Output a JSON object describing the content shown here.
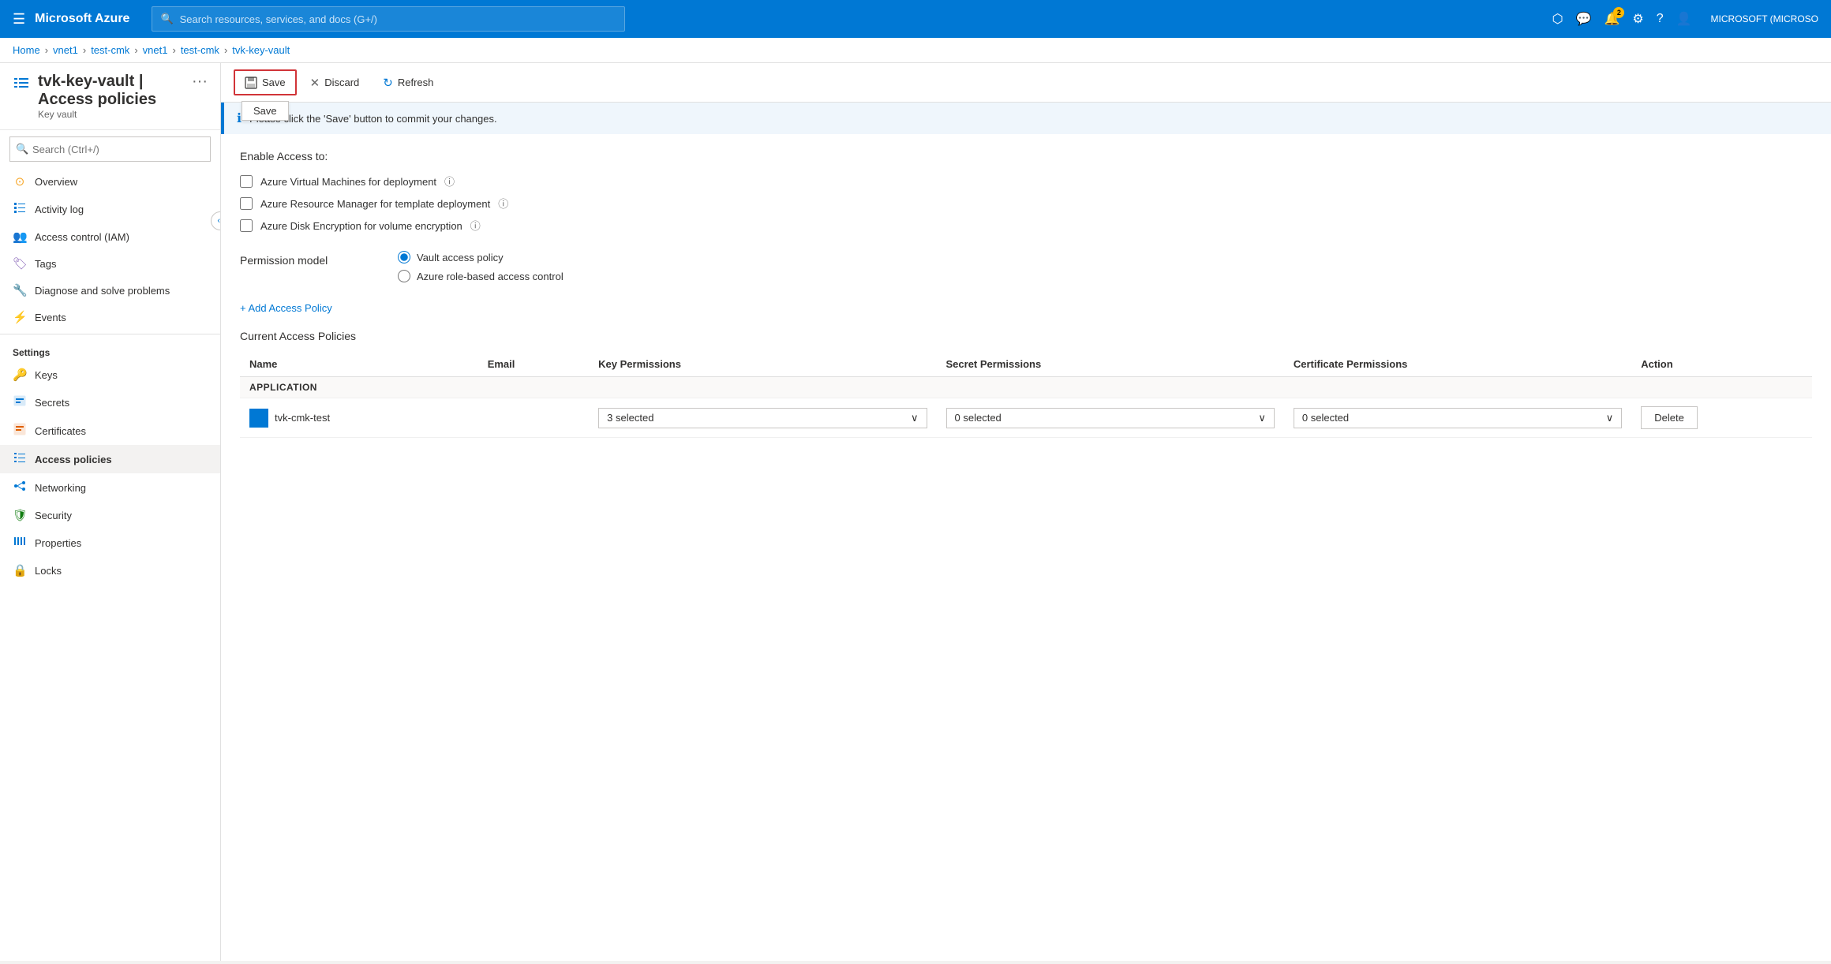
{
  "topnav": {
    "brand": "Microsoft Azure",
    "search_placeholder": "Search resources, services, and docs (G+/)",
    "notification_count": "2",
    "user_label": "MICROSOFT (MICROSO"
  },
  "breadcrumb": {
    "items": [
      "Home",
      "vnet1",
      "test-cmk",
      "vnet1",
      "test-cmk",
      "tvk-key-vault"
    ]
  },
  "page": {
    "title": "tvk-key-vault | Access policies",
    "subtitle": "Key vault"
  },
  "toolbar": {
    "save_label": "Save",
    "discard_label": "Discard",
    "refresh_label": "Refresh",
    "save_tooltip": "Save"
  },
  "info_banner": {
    "message": "Please click the 'Save' button to commit your changes."
  },
  "enable_access": {
    "title": "Enable Access to:",
    "options": [
      {
        "id": "vm",
        "label": "Azure Virtual Machines for deployment",
        "checked": false
      },
      {
        "id": "arm",
        "label": "Azure Resource Manager for template deployment",
        "checked": false
      },
      {
        "id": "disk",
        "label": "Azure Disk Encryption for volume encryption",
        "checked": false
      }
    ]
  },
  "permission_model": {
    "label": "Permission model",
    "options": [
      {
        "id": "vault",
        "label": "Vault access policy",
        "selected": true
      },
      {
        "id": "rbac",
        "label": "Azure role-based access control",
        "selected": false
      }
    ]
  },
  "add_policy": {
    "label": "+ Add Access Policy"
  },
  "current_policies": {
    "title": "Current Access Policies",
    "headers": [
      "Name",
      "Email",
      "Key Permissions",
      "Secret Permissions",
      "Certificate Permissions",
      "Action"
    ],
    "sections": [
      {
        "section_name": "APPLICATION",
        "rows": [
          {
            "name": "tvk-cmk-test",
            "email": "",
            "key_permissions": "3 selected",
            "secret_permissions": "0 selected",
            "certificate_permissions": "0 selected"
          }
        ]
      }
    ]
  },
  "sidebar": {
    "search_placeholder": "Search (Ctrl+/)",
    "items_general": [
      {
        "id": "overview",
        "label": "Overview",
        "icon": "⊙"
      },
      {
        "id": "activity-log",
        "label": "Activity log",
        "icon": "≡"
      },
      {
        "id": "access-control",
        "label": "Access control (IAM)",
        "icon": "👥"
      },
      {
        "id": "tags",
        "label": "Tags",
        "icon": "🏷"
      },
      {
        "id": "diagnose",
        "label": "Diagnose and solve problems",
        "icon": "🔧"
      },
      {
        "id": "events",
        "label": "Events",
        "icon": "⚡"
      }
    ],
    "section_settings": "Settings",
    "items_settings": [
      {
        "id": "keys",
        "label": "Keys",
        "icon": "🔑"
      },
      {
        "id": "secrets",
        "label": "Secrets",
        "icon": "🔒"
      },
      {
        "id": "certificates",
        "label": "Certificates",
        "icon": "📋"
      },
      {
        "id": "access-policies",
        "label": "Access policies",
        "icon": "≡",
        "active": true
      },
      {
        "id": "networking",
        "label": "Networking",
        "icon": "🌐"
      },
      {
        "id": "security",
        "label": "Security",
        "icon": "🛡"
      },
      {
        "id": "properties",
        "label": "Properties",
        "icon": "|||"
      },
      {
        "id": "locks",
        "label": "Locks",
        "icon": "🔒"
      }
    ]
  }
}
